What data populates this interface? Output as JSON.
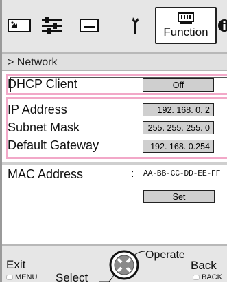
{
  "toolbar": {
    "icons": [
      "picture-icon",
      "adjust-icon",
      "screen-icon",
      "setup-icon",
      "function-icon",
      "info-icon"
    ],
    "active_label": "Function"
  },
  "breadcrumb": {
    "text": "> Network"
  },
  "dhcp": {
    "label": "DHCP Client",
    "value": "Off"
  },
  "ip_address": {
    "label": "IP Address",
    "value": "192. 168.   0.   2"
  },
  "subnet_mask": {
    "label": "Subnet Mask",
    "value": "255. 255. 255.   0"
  },
  "default_gateway": {
    "label": "Default Gateway",
    "value": "192. 168.   0.254"
  },
  "mac": {
    "label": "MAC Address",
    "colon": ":",
    "value": "AA-BB-CC-DD-EE-FF"
  },
  "set_button": {
    "label": "Set"
  },
  "controls": {
    "exit": "Exit",
    "menu": "MENU",
    "select": "Select",
    "operate": "Operate",
    "back": "Back",
    "back_small": "BACK"
  },
  "colors": {
    "highlight": "#f2a8c8",
    "value_box": "#cfcfcf",
    "bar": "#e6e6e6"
  }
}
